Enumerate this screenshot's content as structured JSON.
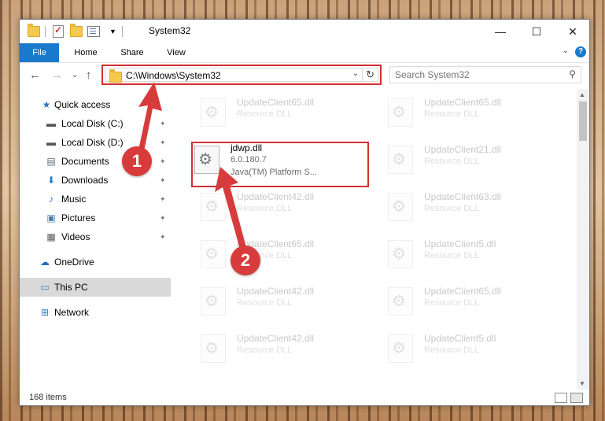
{
  "window": {
    "title": "System32"
  },
  "window_controls": {
    "minimize": "—",
    "maximize": "☐",
    "close": "✕"
  },
  "ribbon": {
    "tabs": [
      "File",
      "Home",
      "Share",
      "View"
    ],
    "help": "?",
    "collapse": "⌄"
  },
  "nav": {
    "back": "←",
    "forward": "→",
    "recent": "⌄",
    "up": "↑",
    "address": "C:\\Windows\\System32",
    "address_dropdown": "⌄",
    "refresh": "↻",
    "search_placeholder": "Search System32",
    "search_icon": "⚲"
  },
  "sidebar": {
    "items": [
      {
        "label": "Quick access",
        "icon": "★",
        "pinned": false
      },
      {
        "label": "Local Disk (C:)",
        "icon": "▬",
        "pinned": true
      },
      {
        "label": "Local Disk (D:)",
        "icon": "▬",
        "pinned": true
      },
      {
        "label": "Documents",
        "icon": "▤",
        "pinned": true
      },
      {
        "label": "Downloads",
        "icon": "⬇",
        "pinned": true
      },
      {
        "label": "Music",
        "icon": "♪",
        "pinned": true
      },
      {
        "label": "Pictures",
        "icon": "▣",
        "pinned": true
      },
      {
        "label": "Videos",
        "icon": "▦",
        "pinned": true
      },
      {
        "label": "OneDrive",
        "icon": "☁",
        "pinned": false
      },
      {
        "label": "This PC",
        "icon": "▭",
        "pinned": false,
        "selected": true
      },
      {
        "label": "Network",
        "icon": "⊞",
        "pinned": false
      }
    ],
    "pin_glyph": "✦"
  },
  "files": {
    "left": [
      {
        "name": "UpdateClient65.dll",
        "type": "Resource DLL",
        "faded": true
      },
      {
        "name": "jdwp.dll",
        "type": "6.0.180.7",
        "desc": "Java(TM) Platform S...",
        "faded": false
      },
      {
        "name": "UpdateClient42.dll",
        "type": "Resource DLL",
        "faded": true
      },
      {
        "name": "UpdateClient65.dll",
        "type": "Resource DLL",
        "faded": true
      },
      {
        "name": "UpdateClient42.dll",
        "type": "Resource DLL",
        "faded": true
      },
      {
        "name": "UpdateClient42.dll",
        "type": "Resource DLL",
        "faded": true
      }
    ],
    "right": [
      {
        "name": "UpdateClient65.dll",
        "type": "Resource DLL",
        "faded": true
      },
      {
        "name": "UpdateClient21.dll",
        "type": "Resource DLL",
        "faded": true
      },
      {
        "name": "UpdateClient63.dll",
        "type": "Resource DLL",
        "faded": true
      },
      {
        "name": "UpdateClient5.dll",
        "type": "Resource DLL",
        "faded": true
      },
      {
        "name": "UpdateClient65.dll",
        "type": "Resource DLL",
        "faded": true
      },
      {
        "name": "UpdateClient5.dll",
        "type": "Resource DLL",
        "faded": true
      }
    ]
  },
  "status": {
    "item_count": "168 items"
  },
  "annotations": {
    "step1": "1",
    "step2": "2",
    "color": "#d83b3b"
  },
  "colors": {
    "accent": "#1979ca",
    "highlight": "#d03030"
  }
}
